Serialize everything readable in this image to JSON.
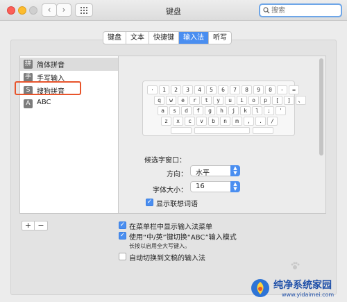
{
  "window": {
    "title": "键盘",
    "nav_back": "‹",
    "nav_forward": "›",
    "search_placeholder": "搜索"
  },
  "tabs": [
    {
      "label": "键盘",
      "active": false
    },
    {
      "label": "文本",
      "active": false
    },
    {
      "label": "快捷键",
      "active": false
    },
    {
      "label": "输入法",
      "active": true
    },
    {
      "label": "听写",
      "active": false
    }
  ],
  "input_sources": [
    {
      "icon_text": "拼",
      "label": "简体拼音",
      "selected": true
    },
    {
      "icon_text": "手",
      "label": "手写输入",
      "selected": false
    },
    {
      "icon_text": "S",
      "label": "搜狗拼音",
      "selected": false
    },
    {
      "icon_text": "A",
      "label": "ABC",
      "selected": false
    }
  ],
  "keyboard_rows": [
    [
      "·",
      "1",
      "2",
      "3",
      "4",
      "5",
      "6",
      "7",
      "8",
      "9",
      "0",
      "-",
      "="
    ],
    [
      "q",
      "w",
      "e",
      "r",
      "t",
      "y",
      "u",
      "i",
      "o",
      "p",
      "[",
      "]",
      "、"
    ],
    [
      "a",
      "s",
      "d",
      "f",
      "g",
      "h",
      "j",
      "k",
      "l",
      ";",
      "'"
    ],
    [
      "z",
      "x",
      "c",
      "v",
      "b",
      "n",
      "m",
      ",",
      ".",
      "/"
    ]
  ],
  "candidate_window": {
    "title": "候选字窗口：",
    "direction_label": "方向：",
    "direction_value": "水平",
    "font_size_label": "字体大小：",
    "font_size_value": "16",
    "show_suggestions_label": "显示联想词语",
    "show_suggestions_checked": true
  },
  "list_controls": {
    "add": "+",
    "remove": "−"
  },
  "options": {
    "show_in_menubar": "在菜单栏中显示输入法菜单",
    "show_in_menubar_checked": true,
    "use_key_switch": "使用“中/英”键切换“ABC”输入模式",
    "use_key_switch_checked": true,
    "use_key_switch_note": "长按以启用全大写键入。",
    "auto_switch": "自动切换到文稿的输入法",
    "auto_switch_checked": false
  },
  "watermark": {
    "title": "纯净系统家园",
    "url": "www.yidaimei.com"
  },
  "colors": {
    "accent": "#4a8ef0",
    "highlight_border": "#e8542b",
    "watermark": "#1e4fa8"
  }
}
